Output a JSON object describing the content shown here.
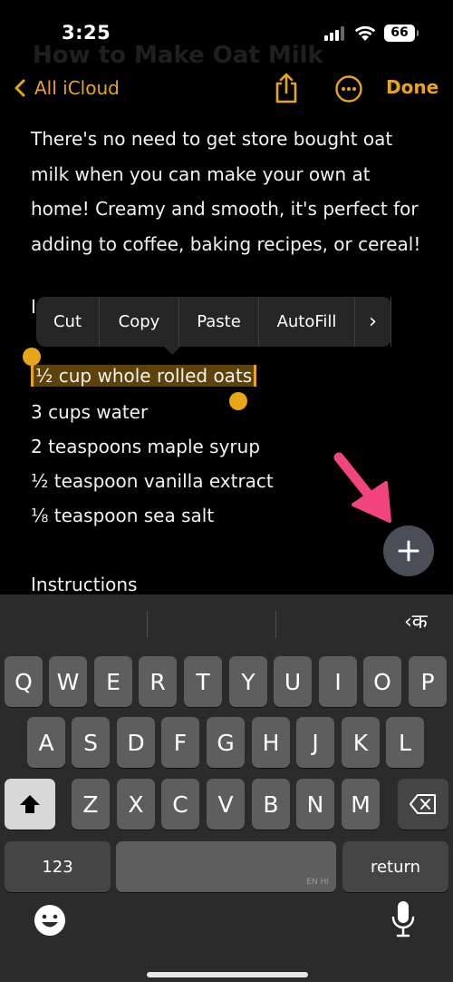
{
  "status": {
    "time": "3:25",
    "battery": "66"
  },
  "note": {
    "ghost_title": "How to Make Oat Milk",
    "intro": "There's no need to get store bought oat milk when you can make your own at home! Creamy and smooth, it's perfect for adding to coffee, baking recipes, or cereal!",
    "ingredients_heading": "I",
    "ingredients": [
      "½ cup whole rolled oats",
      "3 cups water",
      "2 teaspoons maple syrup",
      "½ teaspoon vanilla extract",
      "⅛ teaspoon sea salt"
    ],
    "instructions_heading": "Instructions"
  },
  "nav": {
    "back_label": "All iCloud",
    "done_label": "Done"
  },
  "edit_menu": {
    "cut": "Cut",
    "copy": "Copy",
    "paste": "Paste",
    "autofill": "AutoFill",
    "more": "›"
  },
  "keyboard": {
    "suggestion": "‹क",
    "row1": [
      "Q",
      "W",
      "E",
      "R",
      "T",
      "Y",
      "U",
      "I",
      "O",
      "P"
    ],
    "row2": [
      "A",
      "S",
      "D",
      "F",
      "G",
      "H",
      "J",
      "K",
      "L"
    ],
    "row3": [
      "Z",
      "X",
      "C",
      "V",
      "B",
      "N",
      "M"
    ],
    "numbers": "123",
    "space_sub": "EN HI",
    "return": "return"
  },
  "colors": {
    "accent": "#e8a617",
    "annotation_arrow": "#f2457f"
  }
}
